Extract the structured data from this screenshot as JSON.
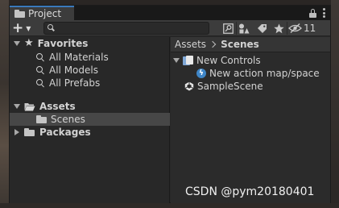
{
  "window": {
    "tab_title": "Project",
    "tab_icon": "folder-icon",
    "lock_icon": "lock-icon",
    "menu_icon": "kebab-menu-icon"
  },
  "toolbar": {
    "add_icon": "plus-icon",
    "add_dropdown_icon": "caret-down-icon",
    "search_value": "",
    "search_icon": "magnifier-icon",
    "buttons": [
      {
        "icon": "search-by-type-icon"
      },
      {
        "icon": "filter-by-type-icon"
      },
      {
        "icon": "filter-by-label-icon"
      },
      {
        "icon": "favorite-star-icon"
      },
      {
        "icon": "hidden-packages-eye-icon",
        "count": "11"
      }
    ]
  },
  "tree": {
    "favorites": {
      "label": "Favorites",
      "items": [
        "All Materials",
        "All Models",
        "All Prefabs"
      ]
    },
    "assets": {
      "label": "Assets",
      "children": [
        "Scenes"
      ],
      "selected": "Scenes"
    },
    "packages": {
      "label": "Packages"
    }
  },
  "right": {
    "breadcrumb": [
      "Assets",
      "Scenes"
    ],
    "items": [
      {
        "label": "New Controls",
        "icon": "input-actions-asset-icon",
        "expanded": true
      },
      {
        "label": "New action map/space",
        "icon": "input-action-icon",
        "child": true
      },
      {
        "label": "SampleScene",
        "icon": "unity-scene-icon"
      }
    ]
  },
  "watermark": "CSDN @pym20180401",
  "colors": {
    "tab_accent": "#3a79bb",
    "selection": "#474747",
    "panel": "#282828"
  }
}
